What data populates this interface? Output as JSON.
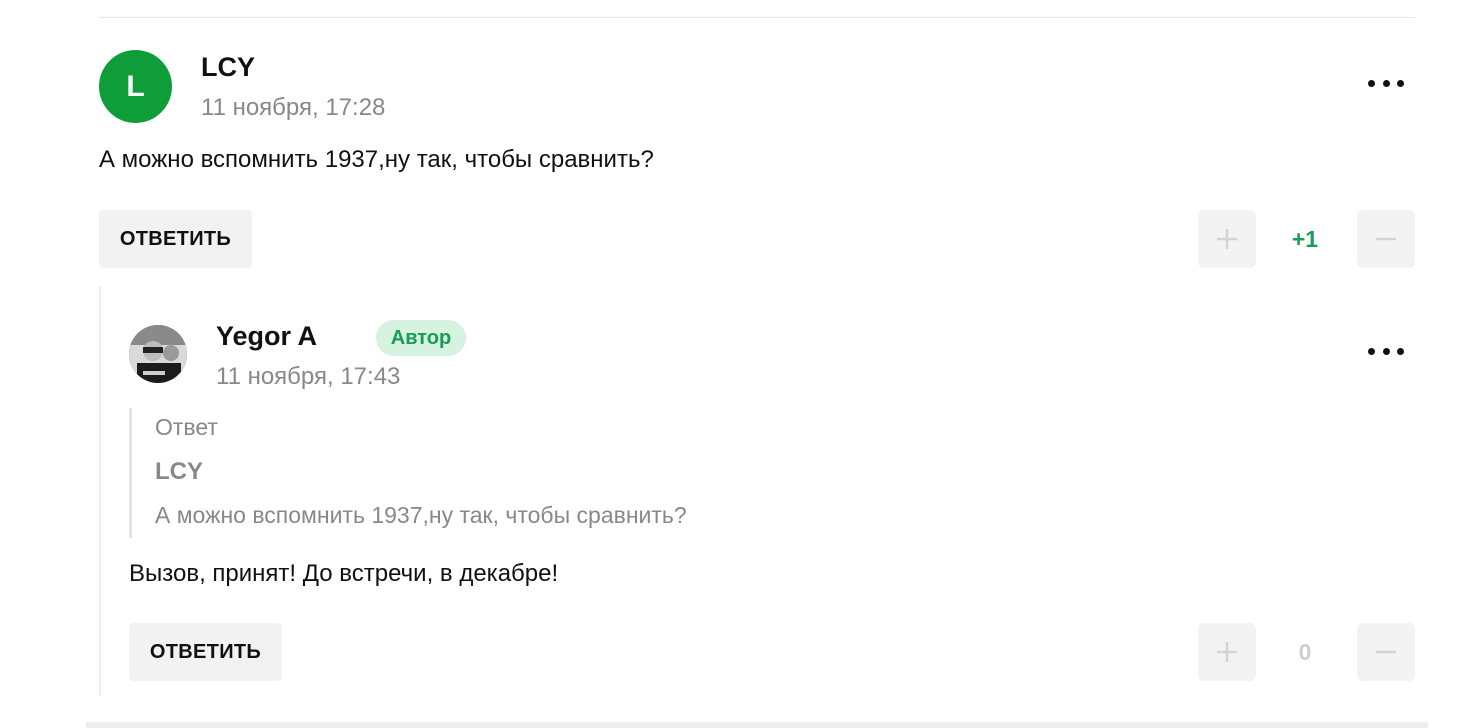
{
  "comments": [
    {
      "avatar_letter": "L",
      "author": "LCY",
      "date": "11 ноября, 17:28",
      "text": "А можно вспомнить 1937,ну так, чтобы сравнить?",
      "reply_label": "ОТВЕТИТЬ",
      "rating": "+1",
      "rating_color": "#1a9c55"
    },
    {
      "author": "Yegor A",
      "badge": "Автор",
      "date": "11 ноября, 17:43",
      "quote": {
        "label": "Ответ",
        "author": "LCY",
        "text": "А можно вспомнить 1937,ну так, чтобы сравнить?"
      },
      "text": "Вызов, принят! До встречи, в декабре!",
      "reply_label": "ОТВЕТИТЬ",
      "rating": "0",
      "rating_color": "#cfcfcf"
    }
  ],
  "icons": {
    "more": "more-horizontal-icon",
    "upvote": "plus-icon",
    "downvote": "minus-icon"
  },
  "colors": {
    "avatar_green": "#0f9d3a",
    "badge_bg": "#d6f2e1",
    "badge_text": "#1a9c55"
  }
}
